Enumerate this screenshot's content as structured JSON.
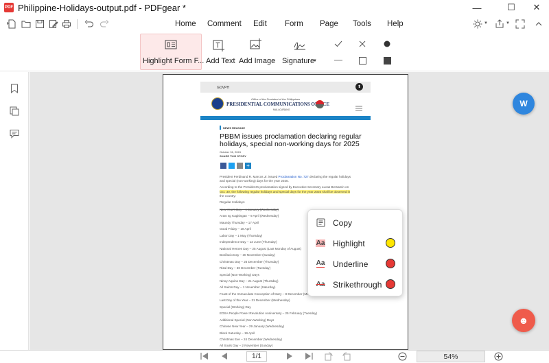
{
  "window": {
    "title": "Philippine-Holidays-output.pdf - PDFgear *",
    "logo_text": "PDF",
    "minimize": "—",
    "maximize": "☐",
    "close": "✕"
  },
  "quick_access": [
    "new-file-icon",
    "open-folder-icon",
    "save-icon",
    "edit-file-icon",
    "print-icon",
    "undo-icon",
    "redo-icon"
  ],
  "menu": {
    "items": [
      "Home",
      "Comment",
      "Edit",
      "Form",
      "Page",
      "Tools",
      "Help"
    ],
    "active": "Form"
  },
  "ribbon": {
    "highlight_form_fields": "Highlight Form F...",
    "add_text": "Add Text",
    "add_image": "Add Image",
    "signature": "Signature",
    "signature_caret": "▼"
  },
  "document": {
    "header_site": "GOVPH",
    "office_small_top": "Office of the President of the Philippines",
    "office_name": "PRESIDENTIAL COMMUNICATIONS OFFICE",
    "office_small_bottom": "MALACAÑANG",
    "news_tag": "NEWS RELEASE",
    "headline_1": "PBBM issues proclamation declaring regular",
    "headline_2": "holidays, special non-working days for 2025",
    "date": "October 31, 2024",
    "share": "SHARE THIS STORY",
    "para1_a": "President Ferdinand R. Marcos Jr. issued",
    "para1_link": "Proclamation No. 727",
    "para1_b": "declaring the regular holidays",
    "para1_c": "and special (non-working) days for the year 2025.",
    "para2_a": "According to the President's proclamation signed by Executive Secretary Lucas Bersamin on",
    "para2_b": "Oct. 30, the following regular holidays and special days for the year 2025 shall be observed in",
    "para2_c": "the country:",
    "regular_heading": "Regular Holidays",
    "holidays": [
      "New Year's Day – 1 January (Wednesday)",
      "Araw ng Kagitingan – 9 April (Wednesday)",
      "Maundy Thursday – 17 April",
      "Good Friday – 18 April",
      "Labor Day – 1 May (Thursday)",
      "Independence Day – 12 June (Thursday)",
      "National Heroes Day – 25 August (Last Monday of August)",
      "Bonifacio Day – 30 November (Sunday)",
      "Christmas Day – 25 December (Thursday)",
      "Rizal Day – 30 December (Tuesday)",
      "Special (Non-Working) Days",
      "Ninoy Aquino Day – 21 August (Thursday)",
      "All Saints Day – 1 November (Saturday)",
      "Feast of the Immaculate Conception of Mary – 8 December (Monday)",
      "Last Day of the Year – 31 December (Wednesday)",
      "Special (Working) Day",
      "EDSA People Power Revolution Anniversary – 25 February (Tuesday)",
      "Additional Special (Non-Working) Days",
      "Chinese New Year – 29 January (Wednesday)",
      "Black Saturday – 19 April",
      "Christmas Eve – 24 December (Wednesday)",
      "All Souls Day – 2 November (Sunday)"
    ]
  },
  "context_menu": {
    "copy": "Copy",
    "highlight": "Highlight",
    "underline": "Underline",
    "strikethrough": "Strikethrough",
    "icon_text": "Aa",
    "colors": {
      "highlight": "#ffe600",
      "underline": "#e53935",
      "strikethrough": "#e53935"
    }
  },
  "floating": {
    "convert_icon": "W",
    "assistant_icon": "☻"
  },
  "bottom": {
    "page_indicator": "1/1",
    "zoom": "54%"
  },
  "colors": {
    "accent": "#e53935",
    "highlight_bg": "#fde9e9",
    "canvas_bg": "#e6e6e6"
  }
}
